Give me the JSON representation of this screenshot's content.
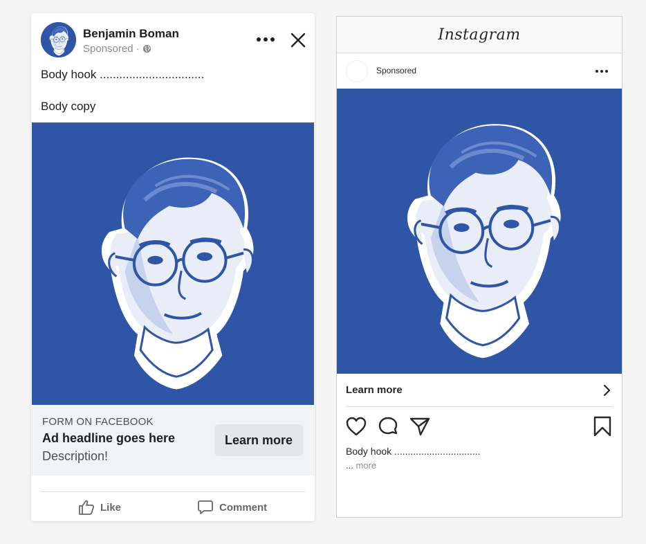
{
  "facebook": {
    "advertiser_name": "Benjamin Boman",
    "sponsored_label": "Sponsored",
    "sponsored_separator": "·",
    "body_hook": "Body hook ................................",
    "body_copy": "Body copy",
    "form_label": "FORM ON FACEBOOK",
    "headline": "Ad headline goes here",
    "description": "Description!",
    "cta_label": "Learn more",
    "actions": {
      "like": "Like",
      "comment": "Comment"
    },
    "icons": [
      "avatar",
      "globe-icon",
      "more-icon",
      "close-icon",
      "like-icon",
      "comment-icon"
    ]
  },
  "instagram": {
    "logo": "Instagram",
    "sponsored_label": "Sponsored",
    "cta_label": "Learn more",
    "caption": "Body hook ................................",
    "caption_ellipsis": "...",
    "caption_more": "more",
    "icons": [
      "more-icon",
      "chevron-right-icon",
      "heart-icon",
      "comment-icon",
      "share-icon",
      "bookmark-icon"
    ]
  },
  "colors": {
    "image_background": "#2f55a6",
    "facebook_cta_strip": "#f2f3f5",
    "facebook_button": "#e4e6eb",
    "page_background": "#f5f5f5"
  }
}
